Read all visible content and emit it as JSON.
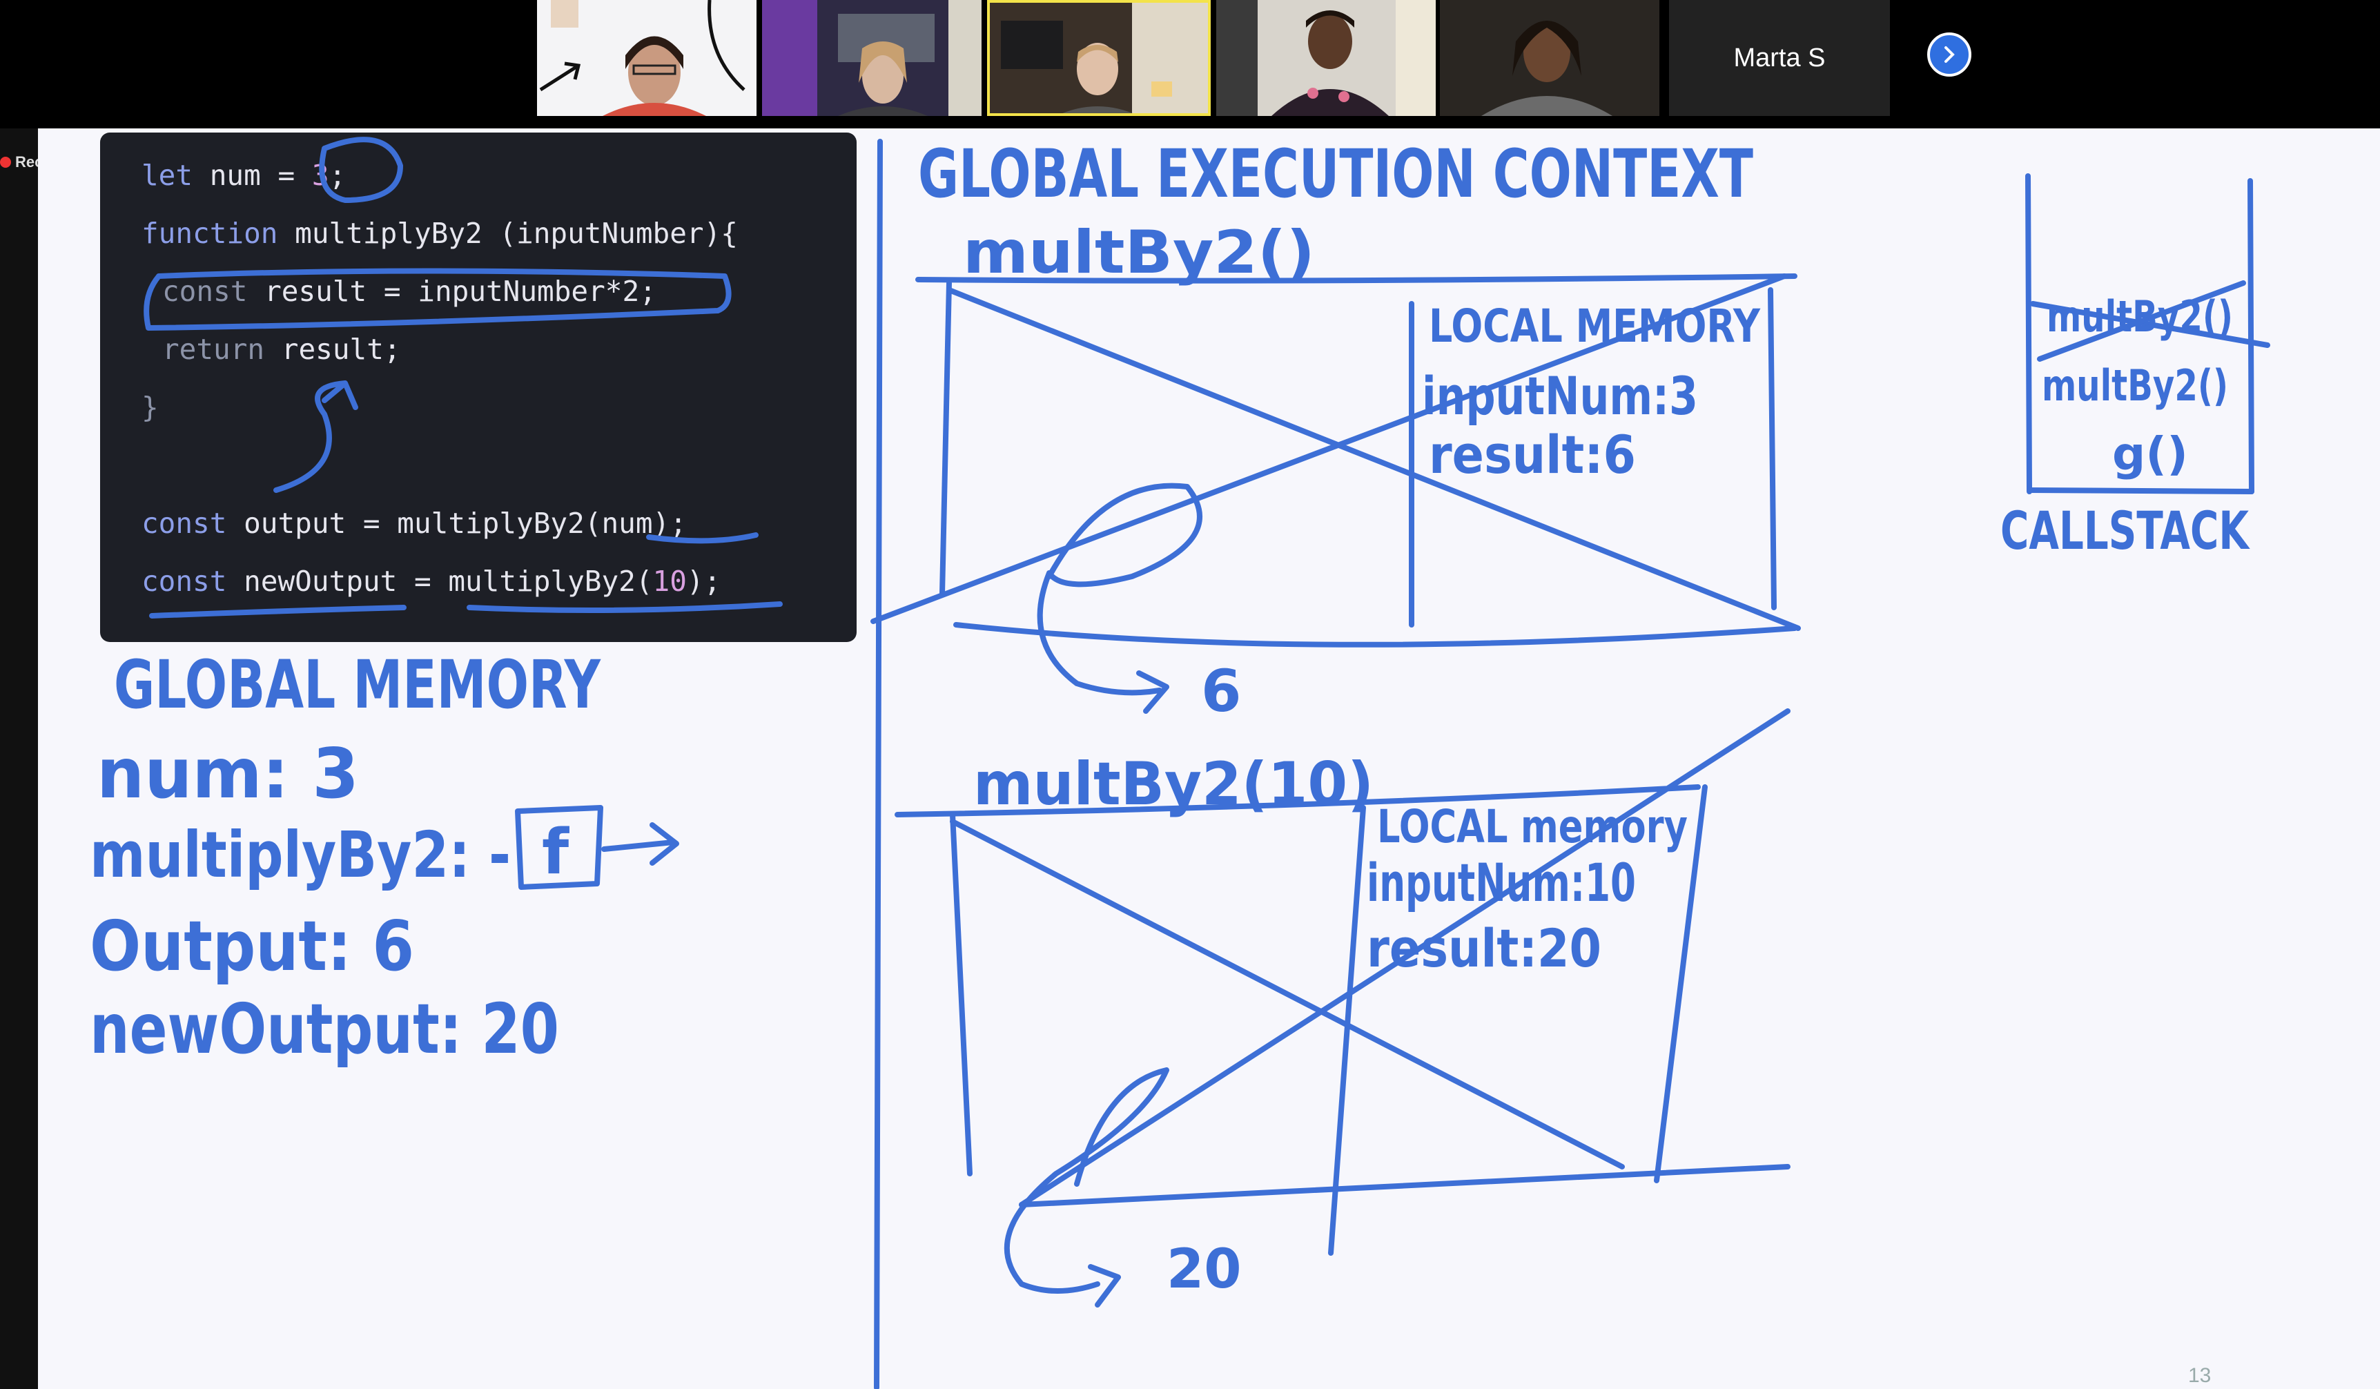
{
  "meeting": {
    "participant_name": "Marta S",
    "recording_label": "Recording",
    "next_icon": "chevron-right-icon",
    "accent": "#2f6fe0",
    "active_speaker_outline": "#f3e34a"
  },
  "code": {
    "l1_kw": "let",
    "l1_rest": " num = ",
    "l1_num": "3",
    "l1_end": ";",
    "l2_kw": "function",
    "l2_rest": " multiplyBy2 (inputNumber){",
    "l3_kw": "const",
    "l3_rest": " result = inputNumber*2;",
    "l4_kw": "return",
    "l4_rest": " result;",
    "l5": "}",
    "l6_kw": "const",
    "l6_rest": " output = multiplyBy2(num);",
    "l7_kw": "const",
    "l7_rest": " newOutput = multiplyBy2(",
    "l7_num": "10",
    "l7_end": ");"
  },
  "board": {
    "gec_title": "GLOBAL EXECUTION CONTEXT",
    "call1_title": "multBy2()",
    "call1_local_title": "LOCAL MEMORY",
    "call1_input": "inputNum:3",
    "call1_result": "result:6",
    "call1_return": "6",
    "call2_title": "multBy2(10)",
    "call2_local_title": "LOCAL memory",
    "call2_input": "inputNum:10",
    "call2_result": "result:20",
    "call2_return": "20",
    "global_memory_title": "GLOBAL MEMORY",
    "gm_num": "num: 3",
    "gm_multiply": "multiplyBy2: -",
    "gm_f": "f",
    "gm_output": "Output: 6",
    "gm_newoutput": "newOutput: 20",
    "stack_item1": "multBy2()",
    "stack_item2": "multBy2()",
    "stack_item3": "g()",
    "callstack_label": "CALLSTACK",
    "ink_color": "#3d6fd6",
    "page_number": "13"
  }
}
